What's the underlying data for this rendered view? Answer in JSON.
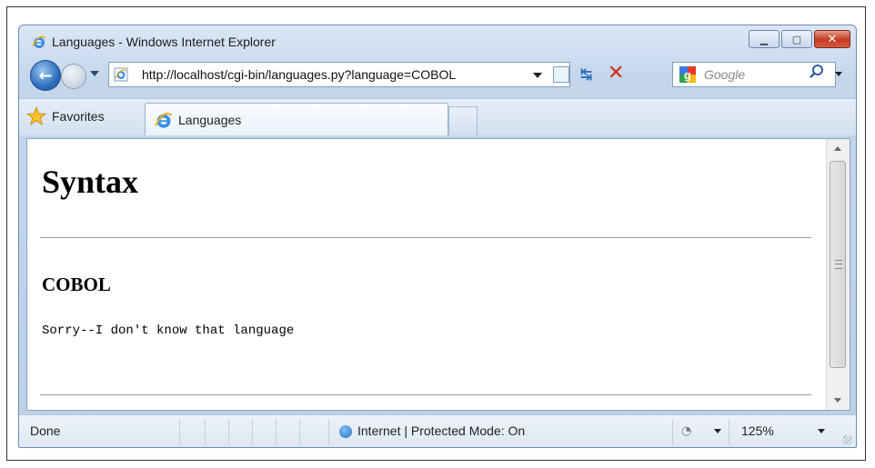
{
  "window": {
    "title": "Languages - Windows Internet Explorer",
    "controls": {
      "minimize_icon": "minimize-icon",
      "maximize_icon": "maximize-icon",
      "close_icon": "close-icon"
    }
  },
  "nav": {
    "address": "http://localhost/cgi-bin/languages.py?language=COBOL",
    "search_placeholder": "Google"
  },
  "tabs": {
    "favorites_label": "Favorites",
    "active_tab_label": "Languages"
  },
  "page": {
    "heading": "Syntax",
    "subheading": "COBOL",
    "message": "Sorry--I don't know that language"
  },
  "status": {
    "text": "Done",
    "zone": "Internet | Protected Mode: On",
    "zoom": "125%"
  }
}
